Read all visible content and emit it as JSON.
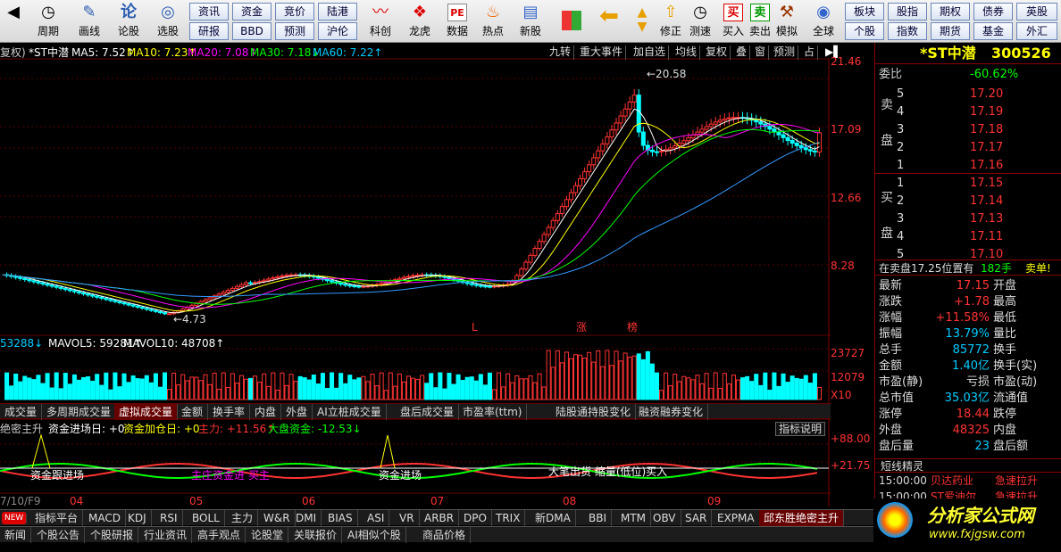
{
  "toolbar": {
    "items": [
      {
        "label": "周期",
        "icon": "calendar-icon",
        "glyph": "📅"
      },
      {
        "label": "画线",
        "icon": "pencil-icon",
        "glyph": "✎"
      },
      {
        "label": "论股",
        "icon": "forum-icon",
        "glyph": "论"
      },
      {
        "label": "选股",
        "icon": "search-icon",
        "glyph": "🔍"
      },
      {
        "label": "科创",
        "icon": "kechuang-icon",
        "glyph": "〰"
      },
      {
        "label": "龙虎",
        "icon": "dragon-tiger-icon",
        "glyph": "❖"
      },
      {
        "label": "数据",
        "icon": "data-icon",
        "glyph": "PE"
      },
      {
        "label": "热点",
        "icon": "hot-icon",
        "glyph": "♨"
      },
      {
        "label": "新股",
        "icon": "ipo-icon",
        "glyph": "▤"
      },
      {
        "label": "修正",
        "icon": "up-icon",
        "glyph": "▲"
      },
      {
        "label": "测速",
        "icon": "clock-icon",
        "glyph": "◷"
      },
      {
        "label": "买入",
        "icon": "buy-icon",
        "glyph": "买"
      },
      {
        "label": "卖出",
        "icon": "sell-icon",
        "glyph": "卖"
      },
      {
        "label": "模拟",
        "icon": "hammer-icon",
        "glyph": "⚒"
      },
      {
        "label": "全球",
        "icon": "globe-icon",
        "glyph": "◉"
      }
    ],
    "grid1": [
      "资讯",
      "资金",
      "竞价",
      "陆港"
    ],
    "grid2": [
      "研报",
      "BBD",
      "预测",
      "沪伦"
    ],
    "grid3": [
      "板块",
      "股指",
      "期权",
      "债券",
      "英股"
    ],
    "grid4": [
      "个股",
      "指数",
      "期货",
      "基金",
      "外汇"
    ]
  },
  "chart": {
    "date_prefix": "7/10/F9",
    "restore": "复权)",
    "name": "*ST中潜",
    "ma5": "MA5: 7.52↑",
    "ma10": "MA10: 7.23↑",
    "ma20": "MA20: 7.08↑",
    "ma30": "MA30: 7.18↓",
    "ma60": "MA60: 7.22↑",
    "top_tabs": [
      "九转",
      "重大事件",
      "加自选",
      "均线",
      "复权",
      "叠",
      "窗",
      "预测",
      "占"
    ],
    "price_axis": [
      "21.46",
      "17.09",
      "12.66",
      "8.28"
    ],
    "high_label": "←20.58",
    "low_label": "←4.73",
    "marks": {
      "L": "L",
      "zhang": "涨",
      "bang": "榜"
    },
    "vol_line": {
      "vol": "53288↓",
      "mavol5": "MAVOL5: 59281↑",
      "mavol10": "MAVOL10: 48708↑"
    },
    "vol_axis": [
      "23727",
      "12079",
      "X10"
    ],
    "sub_tabs": [
      "成交量",
      "多周期成交量",
      "虚拟成交量",
      "金额",
      "换手率",
      "内盘",
      "外盘",
      "AI立桩成交量",
      "盘后成交量",
      "市盈率(ttm)",
      "陆股通持股变化",
      "融资融券变化"
    ],
    "ind_line": {
      "name": "绝密主升",
      "c1": "资金进场日: +0",
      "c2": "资金加仓日: +0",
      "c3": "主力: +11.56↑",
      "c4": "大盘资金: -12.53↓"
    },
    "ind_btn": "指标说明",
    "ind_axis": [
      "+88.00",
      "+21.75"
    ],
    "ind_texts": [
      "资金跟进场",
      "主庄资金进 买主",
      "资金进场",
      "大笔出货 缩量(低位)买入"
    ],
    "months": [
      "04",
      "05",
      "06",
      "07",
      "08",
      "09"
    ],
    "watermark": "www.fxjgsw.Com 分析家公式网"
  },
  "quote": {
    "title": "*ST中潜",
    "code": "300526",
    "weibi_label": "委比",
    "weibi": "-60.62%",
    "sell_label": [
      "卖",
      "盘"
    ],
    "buy_label": [
      "买",
      "盘"
    ],
    "asks": [
      [
        "5",
        "17.20"
      ],
      [
        "4",
        "17.19"
      ],
      [
        "3",
        "17.18"
      ],
      [
        "2",
        "17.17"
      ],
      [
        "1",
        "17.16"
      ]
    ],
    "bids": [
      [
        "1",
        "17.15"
      ],
      [
        "2",
        "17.14"
      ],
      [
        "3",
        "17.13"
      ],
      [
        "4",
        "17.11"
      ],
      [
        "5",
        "17.10"
      ]
    ],
    "notice": {
      "text": "在卖盘17.25位置有",
      "qty": "182手",
      "act": "卖单!"
    },
    "stats": [
      [
        "最新",
        "17.15",
        "开盘",
        ""
      ],
      [
        "涨跌",
        "+1.78",
        "最高",
        ""
      ],
      [
        "涨幅",
        "+11.58%",
        "最低",
        ""
      ],
      [
        "振幅",
        "13.79%",
        "量比",
        ""
      ],
      [
        "总手",
        "85772",
        "换手",
        ""
      ],
      [
        "金额",
        "1.40亿",
        "换手(实)",
        ""
      ],
      [
        "市盈(静)",
        "亏损",
        "市盈(动)",
        ""
      ],
      [
        "总市值",
        "35.03亿",
        "流通值",
        ""
      ],
      [
        "涨停",
        "18.44",
        "跌停",
        ""
      ],
      [
        "外盘",
        "48325",
        "内盘",
        ""
      ],
      [
        "盘后量",
        "23",
        "盘后额",
        ""
      ]
    ],
    "jingling": "短线精灵",
    "alerts": [
      [
        "15:00:00",
        "贝达药业",
        "急速拉升"
      ],
      [
        "15:00:00",
        "ST爱迪尔",
        "急速拉升"
      ]
    ]
  },
  "bottom": {
    "tabs": [
      "指标平台",
      "MACD",
      "KDJ",
      "RSI",
      "BOLL",
      "主力",
      "W&R",
      "DMI",
      "BIAS",
      "ASI",
      "VR",
      "ARBR",
      "DPO",
      "TRIX",
      "新DMA",
      "BBI",
      "MTM",
      "OBV",
      "SAR",
      "EXPMA",
      "邱东胜绝密主升"
    ],
    "new_badge": "NEW",
    "links": [
      "新闻",
      "个股公告",
      "个股研报",
      "行业资讯",
      "高手观点",
      "论股堂",
      "关联报价",
      "AI相似个股",
      "商品价格"
    ],
    "logo": "分析家公式网",
    "logo_url": "www.fxjgsw.com"
  },
  "chart_data": {
    "type": "candlestick",
    "title": "*ST中潜",
    "y_ticks": [
      21.46,
      17.09,
      12.66,
      8.28
    ],
    "ylim": [
      4.0,
      22.0
    ],
    "x": [
      "04",
      "05",
      "06",
      "07",
      "08",
      "09"
    ],
    "high": 20.58,
    "low": 4.73,
    "last": 17.15
  }
}
